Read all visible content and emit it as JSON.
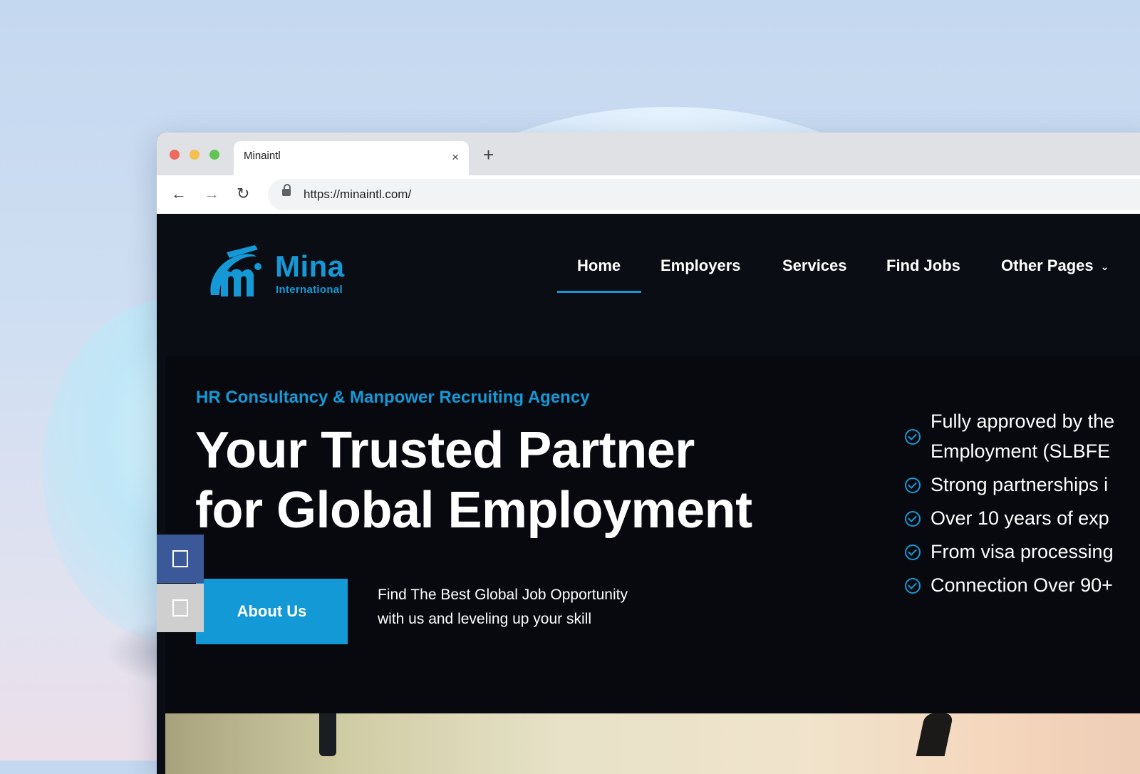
{
  "browser": {
    "tab_title": "Minaintl",
    "tab_close": "×",
    "new_tab": "+",
    "url": "https://minaintl.com/",
    "back": "←",
    "forward": "→",
    "reload": "↻"
  },
  "site": {
    "logo": {
      "name": "Mina",
      "subtitle": "International"
    },
    "nav": [
      {
        "label": "Home",
        "active": true
      },
      {
        "label": "Employers",
        "active": false
      },
      {
        "label": "Services",
        "active": false
      },
      {
        "label": "Find Jobs",
        "active": false
      },
      {
        "label": "Other Pages",
        "active": false,
        "has_dropdown": true
      }
    ],
    "hero": {
      "kicker": "HR Consultancy & Manpower Recruiting Agency",
      "headline_line1": "Your Trusted Partner",
      "headline_line2": "for Global Employment",
      "cta_label": "About Us",
      "text_line1": "Find The Best Global Job Opportunity",
      "text_line2": "with us and leveling up your skill"
    },
    "features": [
      {
        "line1": "Fully approved by the",
        "line2": "Employment (SLBFE"
      },
      {
        "line1": "Strong partnerships i"
      },
      {
        "line1": "Over 10 years of exp"
      },
      {
        "line1": "From visa processing"
      },
      {
        "line1": "Connection Over 90+"
      }
    ],
    "colors": {
      "accent": "#1499d6",
      "background": "#0a0d14",
      "facebook": "#3b5998"
    }
  }
}
